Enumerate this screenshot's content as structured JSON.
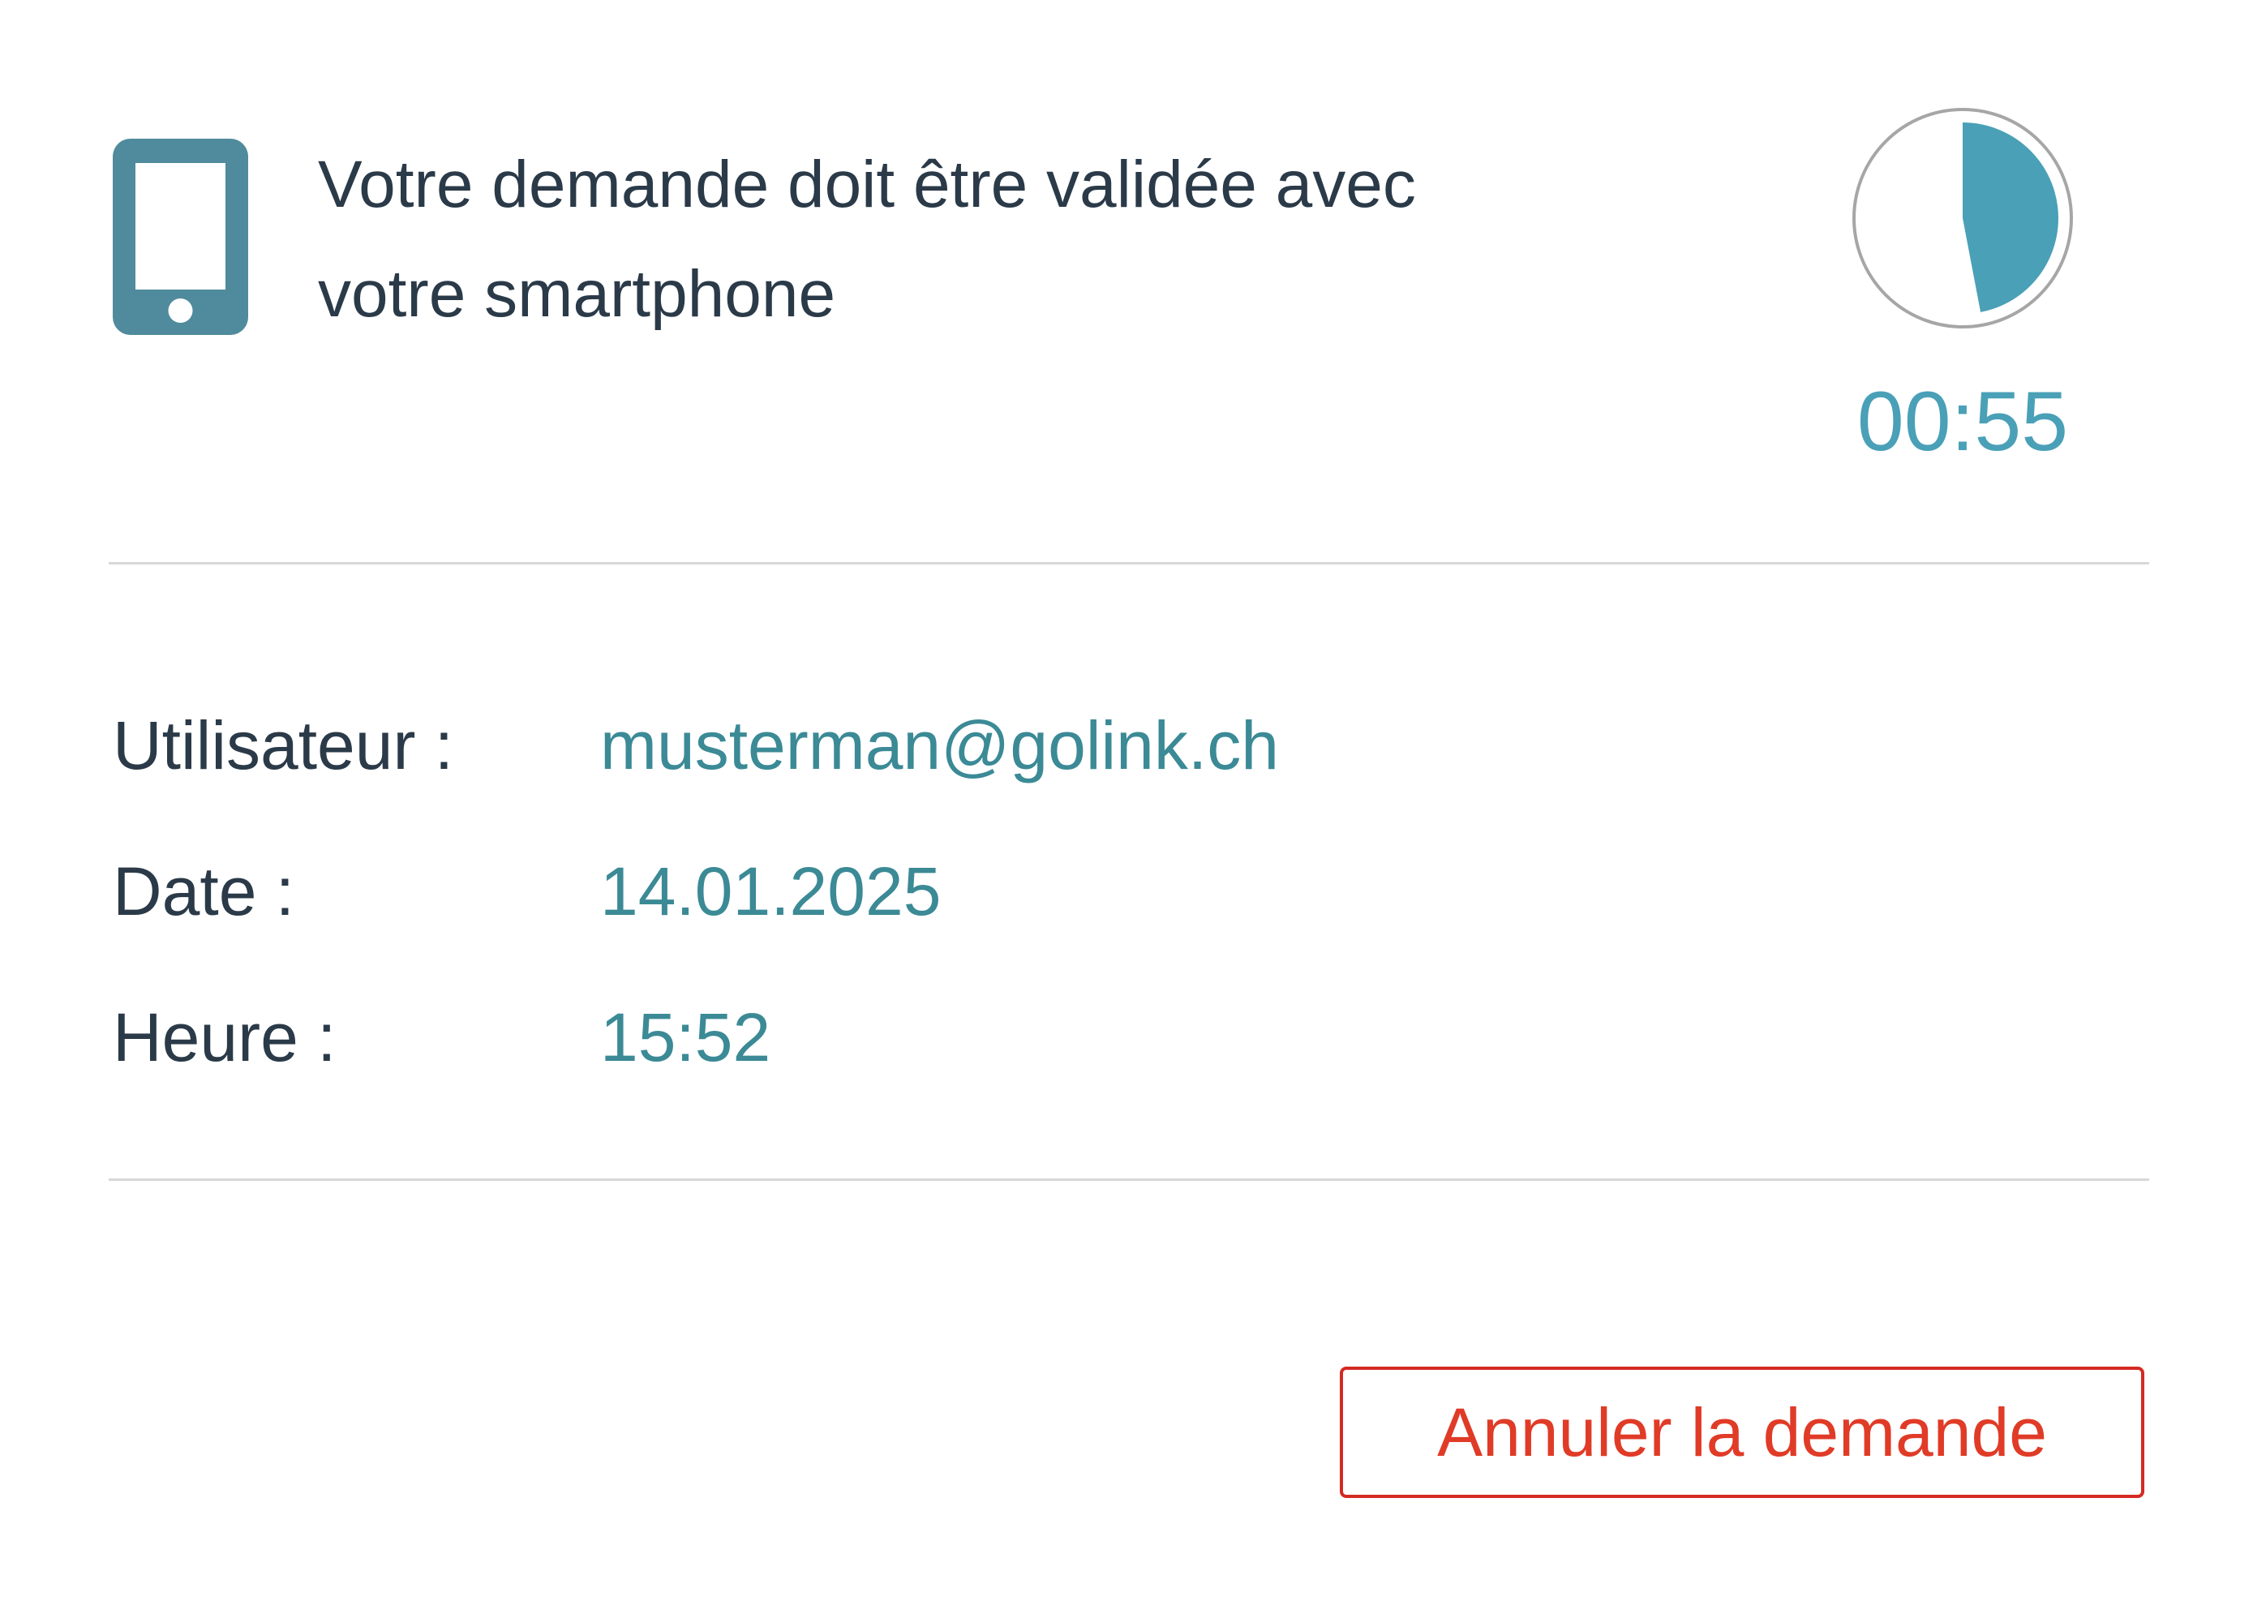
{
  "header": {
    "icon": "smartphone-icon",
    "message_line1": "Votre demande doit être validée avec",
    "message_line2": "votre smartphone"
  },
  "timer": {
    "icon": "countdown-pie-icon",
    "display": "00:55",
    "remaining_fraction": 0.47,
    "color": "#4aa0b7"
  },
  "details": {
    "user": {
      "label": "Utilisateur :",
      "value": "musterman@golink.ch"
    },
    "date": {
      "label": "Date :",
      "value": "14.01.2025"
    },
    "time": {
      "label": "Heure :",
      "value": "15:52"
    }
  },
  "actions": {
    "cancel_label": "Annuler la demande",
    "cancel_color": "#d42a22"
  },
  "colors": {
    "text": "#2b3a48",
    "value": "#3b8a96",
    "icon": "#4f8b9c",
    "divider": "#d8d8d8"
  }
}
